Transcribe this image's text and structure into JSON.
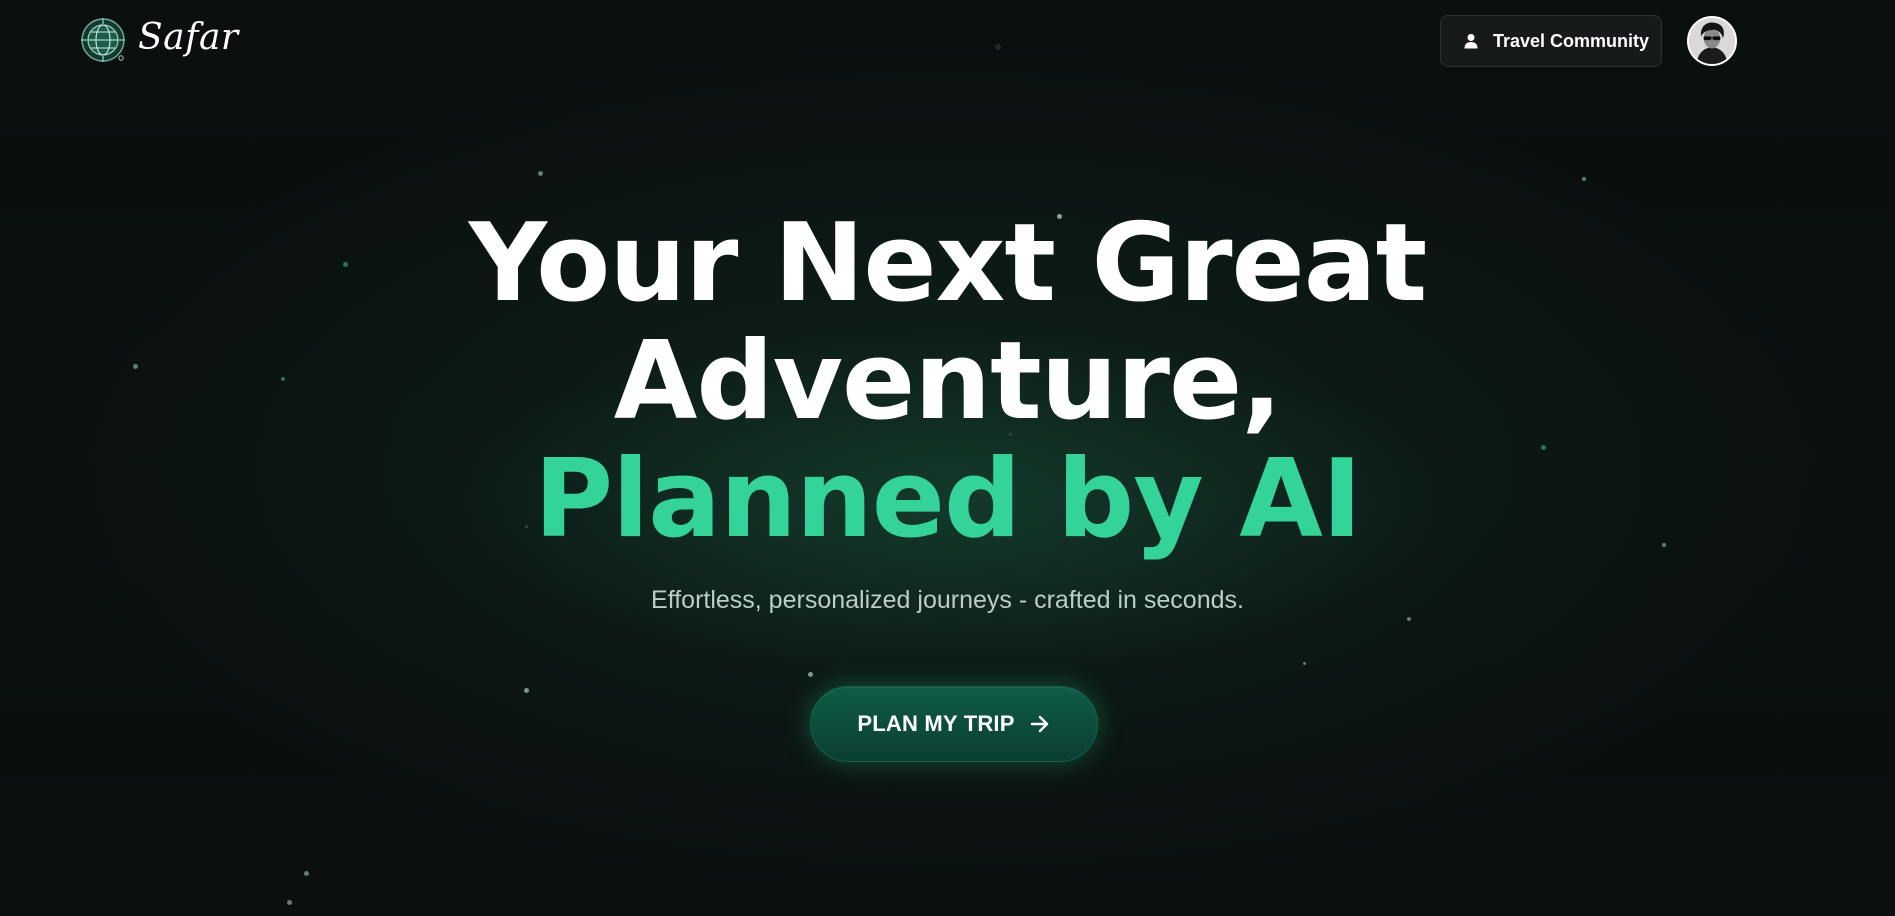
{
  "brand": {
    "name": "Safar",
    "icon": "globe-compass-icon",
    "accent_color": "#34d399"
  },
  "header": {
    "community_button": {
      "label": "Travel Community",
      "icon": "user-icon"
    },
    "avatar": {
      "icon": "user-avatar"
    }
  },
  "hero": {
    "headline_line1": "Your Next Great",
    "headline_line2": "Adventure,",
    "headline_accent": "Planned by AI",
    "subtitle": "Effortless, personalized journeys - crafted in seconds.",
    "cta": {
      "label": "PLAN MY TRIP",
      "icon": "arrow-right-icon"
    }
  },
  "colors": {
    "background": "#0a0f0e",
    "accent": "#34d399",
    "cta_background": "#0f5c46",
    "subtitle": "#b9cec6"
  }
}
